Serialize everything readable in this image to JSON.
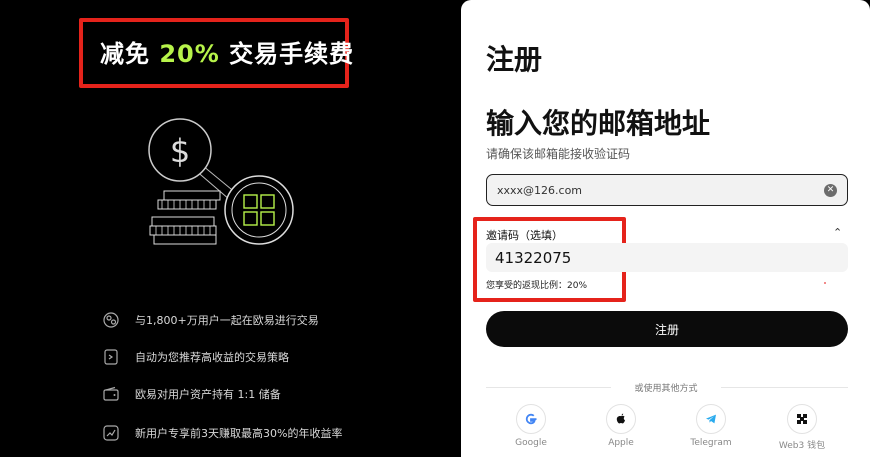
{
  "promo": {
    "title_prefix": "减免 ",
    "title_highlight": "20%",
    "title_suffix": " 交易手续费",
    "highlight_color": "#b7f34a",
    "box_color": "#e5231b"
  },
  "features": [
    {
      "icon": "users-icon",
      "text": "与1,800+万用户一起在欧易进行交易"
    },
    {
      "icon": "strategy-icon",
      "text": "自动为您推荐高收益的交易策略"
    },
    {
      "icon": "wallet-icon",
      "text": "欧易对用户资产持有 1:1 储备"
    },
    {
      "icon": "growth-chart-icon",
      "text": "新用户专享前3天赚取最高30%的年收益率"
    }
  ],
  "form": {
    "title": "注册",
    "email_heading": "输入您的邮箱地址",
    "email_subtitle": "请确保该邮箱能接收验证码",
    "email_value": "xxxx@126.com",
    "invite_label": "邀请码（选填）",
    "invite_value": "41322075",
    "invite_hint": "您享受的返现比例：20%",
    "submit_label": "注册",
    "other_methods": "或使用其他方式"
  },
  "social": [
    {
      "icon": "google-icon",
      "label": "Google"
    },
    {
      "icon": "apple-icon",
      "label": "Apple"
    },
    {
      "icon": "telegram-icon",
      "label": "Telegram"
    },
    {
      "icon": "web3-wallet-icon",
      "label": "Web3 钱包"
    }
  ]
}
